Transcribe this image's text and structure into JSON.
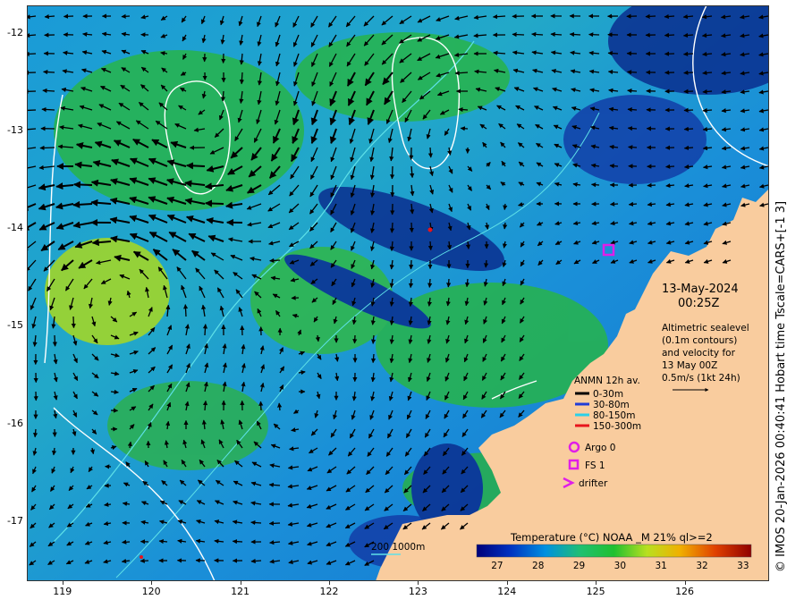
{
  "map": {
    "lon_ticks": [
      "119",
      "120",
      "121",
      "122",
      "123",
      "124",
      "125",
      "126"
    ],
    "lat_ticks": [
      "-12",
      "-13",
      "-14",
      "-15",
      "-16",
      "-17"
    ],
    "lon_range": [
      118.6,
      126.95
    ],
    "lat_range": [
      -12.0,
      -17.9
    ],
    "colors": {
      "land": "#f9cc9e",
      "sea_mid": "#1a9ad8",
      "sea_deep": "#0a2e8f",
      "sea_green": "#27b44a",
      "contour_ssh": "#ffffff",
      "contour_depth": "#5ee0e8",
      "arrow": "#000000"
    }
  },
  "date": {
    "line1": "13-May-2024",
    "line2": "00:25Z"
  },
  "altimetry": {
    "lines": [
      "Altimetric sealevel",
      "(0.1m contours)",
      "and velocity for",
      "13 May 00Z",
      "0.5m/s (1kt 24h)"
    ]
  },
  "anmn": {
    "title": "ANMN 12h av.",
    "items": [
      {
        "label": "0-30m",
        "color": "#000000"
      },
      {
        "label": "30-80m",
        "color": "#1f3bd8"
      },
      {
        "label": "80-150m",
        "color": "#2ad0e8"
      },
      {
        "label": "150-300m",
        "color": "#e8141c"
      }
    ]
  },
  "markers": {
    "argo": "Argo 0",
    "fs": "FS 1",
    "drifter": "drifter",
    "color": "#e01ee8"
  },
  "isobath": {
    "label": "200  1000m"
  },
  "colorbar": {
    "title": "Temperature (°C) NOAA _M 21% ql>=2",
    "ticks": [
      "27",
      "28",
      "29",
      "30",
      "31",
      "32",
      "33"
    ],
    "range": [
      26.5,
      33.2
    ],
    "stops": [
      "#00007a",
      "#0030c0",
      "#0090e0",
      "#20c070",
      "#20c030",
      "#b8e020",
      "#f0b000",
      "#e04000",
      "#900000"
    ]
  },
  "credit": "© IMOS 20-Jan-2026 00:40:41 Hobart time Tscale=CARS+[-1 3]"
}
